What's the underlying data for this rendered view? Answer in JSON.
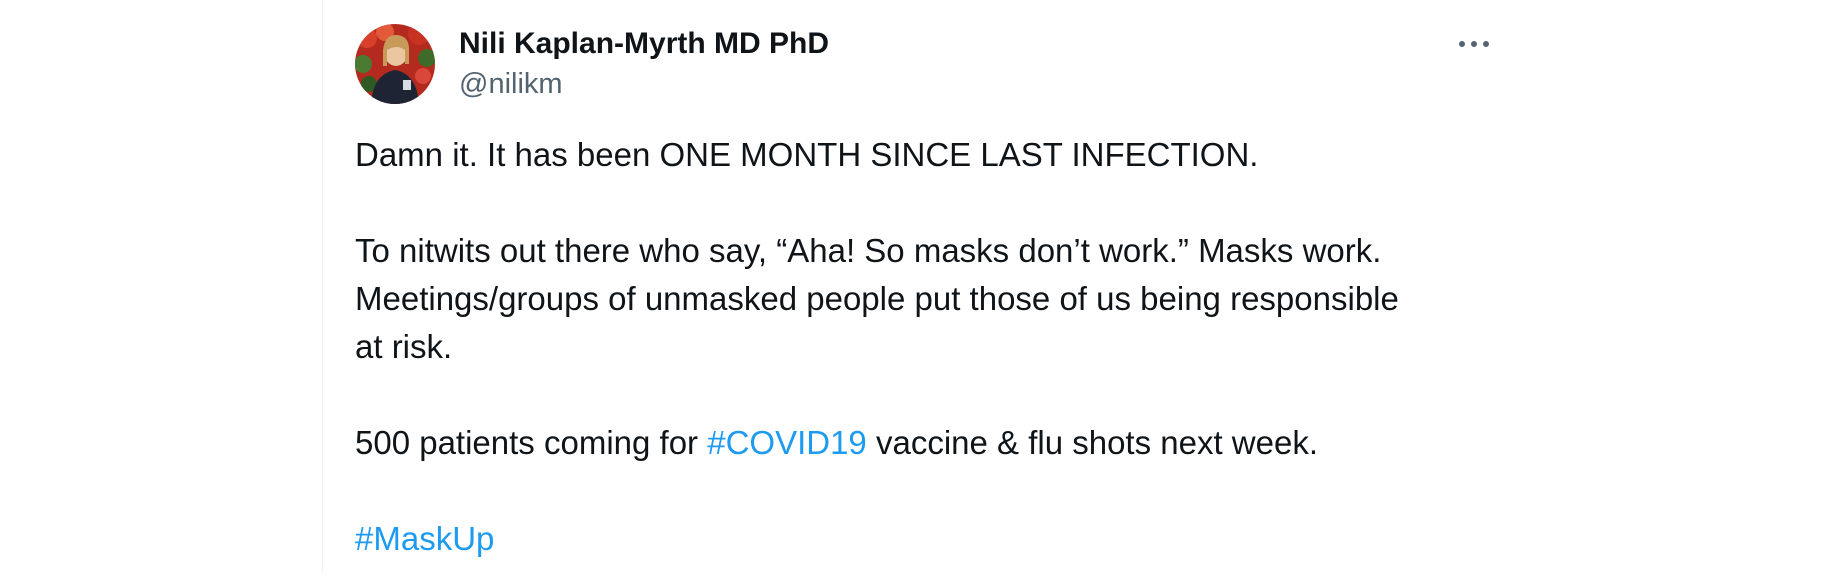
{
  "author": {
    "display_name": "Nili Kaplan-Myrth MD PhD",
    "handle": "@nilikm",
    "avatar_icon": "profile-photo"
  },
  "more_icon": "more-horizontal-icon",
  "tweet": {
    "line1": "Damn it. It has been ONE MONTH SINCE LAST INFECTION.",
    "line2": "To nitwits out there who say, “Aha! So masks don’t work.” Masks work.",
    "line3": "Meetings/groups of unmasked people put those of us being responsible",
    "line4": "at risk.",
    "line5_before": "500 patients coming for ",
    "line5_hashtag": "#COVID19",
    "line5_after": " vaccine & flu shots next week.",
    "line6_hashtag": "#MaskUp"
  },
  "colors": {
    "text": "#0f1419",
    "secondary": "#536471",
    "link": "#1d9bf0",
    "border": "#eff3f4"
  }
}
